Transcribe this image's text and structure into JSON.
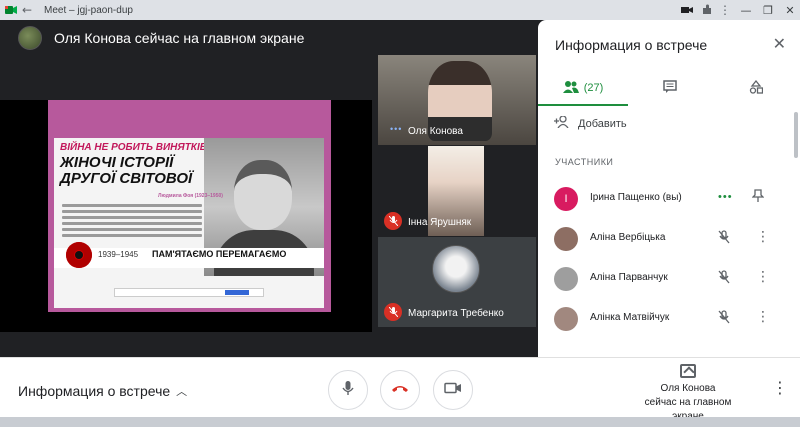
{
  "browser": {
    "title": "Meet – jgj-paon-dup",
    "back_glyph": "←",
    "window_controls": [
      "—",
      "❐",
      "✕"
    ]
  },
  "stage": {
    "presenter_title": "Оля Конова сейчас на главном экране",
    "slide": {
      "line1": "ВІЙНА НЕ РОБИТЬ ВИНЯТКІВ.",
      "line2": "ЖІНОЧІ ІСТОРІЇ ДРУГОЇ СВІТОВОЇ",
      "author": "Людмила Фоя (1923–1950)",
      "years": "1939–1945",
      "slogan": "ПАМ'ЯТАЄМО ПЕРЕМАГАЄМО"
    },
    "tiles": [
      {
        "name": "Оля Конова",
        "state": "speaking"
      },
      {
        "name": "Інна Ярушняк",
        "state": "muted"
      },
      {
        "name": "Маргарита Требенко",
        "state": "muted"
      }
    ]
  },
  "panel": {
    "title": "Информация о встрече",
    "people_count": "(27)",
    "add_label": "Добавить",
    "section_label": "УЧАСТНИКИ",
    "participants": [
      {
        "name": "Ірина Пащенко (вы)",
        "avatar_color": "#d81b60",
        "initial": "І"
      },
      {
        "name": "Аліна Вербіцька",
        "avatar_color": "#8d6e63"
      },
      {
        "name": "Аліна Парванчук",
        "avatar_color": "#9e9e9e"
      },
      {
        "name": "Алінка Матвійчук",
        "avatar_color": "#a1887f"
      }
    ]
  },
  "bottombar": {
    "info_label": "Информация о встрече",
    "present_line1": "Оля Конова",
    "present_line2": "сейчас на главном экране"
  },
  "colors": {
    "accent_green": "#1e8e3e",
    "hangup_red": "#d93025",
    "slide_frame": "#b7599c"
  }
}
